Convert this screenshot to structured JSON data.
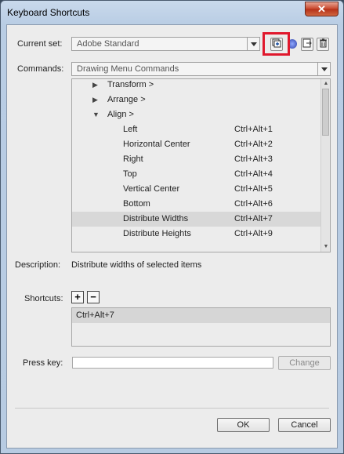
{
  "window": {
    "title": "Keyboard Shortcuts",
    "close_glyph": "✕"
  },
  "current_set": {
    "label": "Current set:",
    "value": "Adobe Standard"
  },
  "commands": {
    "label": "Commands:",
    "value": "Drawing Menu Commands"
  },
  "set_icons": [
    "duplicate-set-icon",
    "rename-set-icon",
    "export-set-icon",
    "delete-set-icon"
  ],
  "tree": [
    {
      "tri": "▶",
      "name": "Transform >",
      "key": "",
      "level": 0
    },
    {
      "tri": "▶",
      "name": "Arrange >",
      "key": "",
      "level": 0
    },
    {
      "tri": "▼",
      "name": "Align >",
      "key": "",
      "level": 0
    },
    {
      "tri": "",
      "name": "Left",
      "key": "Ctrl+Alt+1",
      "level": 1
    },
    {
      "tri": "",
      "name": "Horizontal Center",
      "key": "Ctrl+Alt+2",
      "level": 1
    },
    {
      "tri": "",
      "name": "Right",
      "key": "Ctrl+Alt+3",
      "level": 1
    },
    {
      "tri": "",
      "name": "Top",
      "key": "Ctrl+Alt+4",
      "level": 1
    },
    {
      "tri": "",
      "name": "Vertical Center",
      "key": "Ctrl+Alt+5",
      "level": 1
    },
    {
      "tri": "",
      "name": "Bottom",
      "key": "Ctrl+Alt+6",
      "level": 1
    },
    {
      "tri": "",
      "name": "Distribute Widths",
      "key": "Ctrl+Alt+7",
      "level": 1,
      "selected": true
    },
    {
      "tri": "",
      "name": "Distribute Heights",
      "key": "Ctrl+Alt+9",
      "level": 1
    }
  ],
  "description": {
    "label": "Description:",
    "text": "Distribute widths of selected items"
  },
  "shortcuts": {
    "label": "Shortcuts:",
    "add": "+",
    "remove": "−",
    "items": [
      "Ctrl+Alt+7"
    ]
  },
  "press_key": {
    "label": "Press key:",
    "value": "",
    "change_label": "Change"
  },
  "buttons": {
    "ok": "OK",
    "cancel": "Cancel"
  },
  "colors": {
    "highlight": "#e0182d",
    "selected_row": "#d8d8d8"
  }
}
